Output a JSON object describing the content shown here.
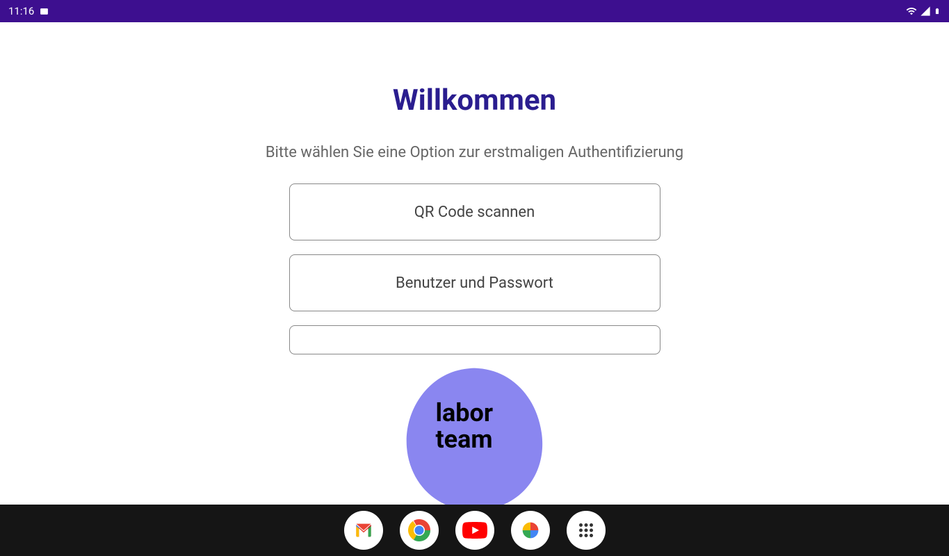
{
  "status_bar": {
    "time": "11:16"
  },
  "main": {
    "title": "Willkommen",
    "subtitle": "Bitte wählen Sie eine Option zur erstmaligen Authentifizierung",
    "buttons": {
      "qr_scan": "QR Code scannen",
      "user_password": "Benutzer und Passwort",
      "third": ""
    },
    "logo": {
      "line1": "labor",
      "line2": "team"
    }
  },
  "nav": {
    "apps": [
      "gmail",
      "chrome",
      "youtube",
      "photos",
      "app-drawer"
    ]
  },
  "colors": {
    "status_bar": "#3d0f8f",
    "title": "#2a1d8f",
    "logo_blob": "#8a86f0"
  }
}
